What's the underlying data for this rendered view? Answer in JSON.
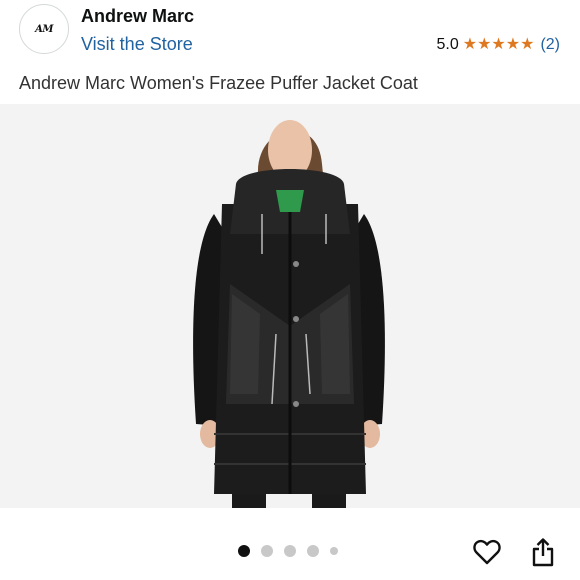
{
  "store": {
    "logo_text": "AM",
    "brand_name": "Andrew Marc",
    "visit_label": "Visit the Store"
  },
  "rating": {
    "value": "5.0",
    "stars": 5,
    "count": "(2)",
    "star_color": "#de7921"
  },
  "product": {
    "title": "Andrew Marc Women's Frazee Puffer Jacket Coat"
  },
  "gallery": {
    "total_images": 5,
    "active_index": 0
  },
  "actions": {
    "wishlist_icon": "heart-outline-icon",
    "share_icon": "share-icon"
  },
  "colors": {
    "link": "#2162a1",
    "text": "#0f1111"
  }
}
